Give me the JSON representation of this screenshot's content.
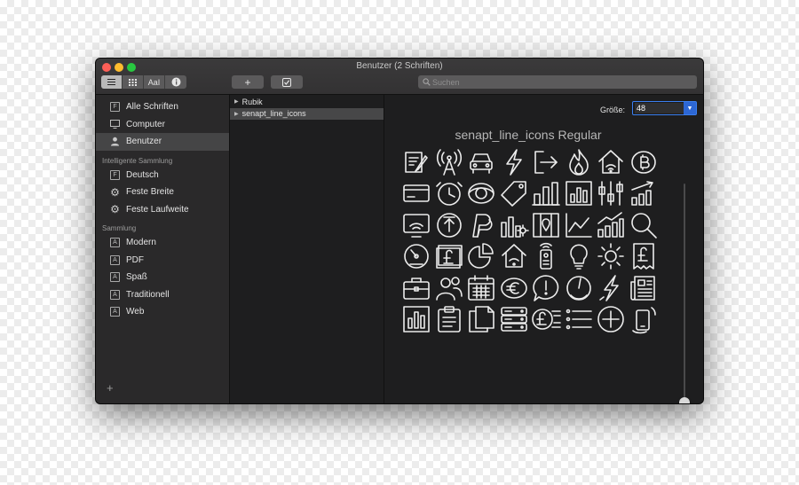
{
  "window": {
    "title": "Benutzer (2 Schriften)"
  },
  "toolbar": {
    "view_buttons": [
      "≡",
      "⋮⋮",
      "AaI",
      "i"
    ],
    "add_label": "+",
    "validate_label": "☑",
    "search_placeholder": "Suchen"
  },
  "sidebar": {
    "library": [
      {
        "label": "Alle Schriften",
        "icon": "font-book-icon"
      },
      {
        "label": "Computer",
        "icon": "monitor-icon"
      },
      {
        "label": "Benutzer",
        "icon": "user-icon",
        "selected": true
      }
    ],
    "smart_header": "Intelligente Sammlung",
    "smart": [
      {
        "label": "Deutsch",
        "icon": "font-book-icon"
      },
      {
        "label": "Feste Breite",
        "icon": "gear-icon"
      },
      {
        "label": "Feste Laufweite",
        "icon": "gear-icon"
      }
    ],
    "collection_header": "Sammlung",
    "collections": [
      {
        "label": "Modern",
        "icon": "font-a-icon"
      },
      {
        "label": "PDF",
        "icon": "font-a-icon"
      },
      {
        "label": "Spaß",
        "icon": "font-a-icon"
      },
      {
        "label": "Traditionell",
        "icon": "font-a-icon"
      },
      {
        "label": "Web",
        "icon": "font-a-icon"
      }
    ],
    "add_label": "+"
  },
  "font_list": [
    {
      "label": "Rubik",
      "selected": false
    },
    {
      "label": "senapt_line_icons",
      "selected": true
    }
  ],
  "preview": {
    "size_label": "Größe:",
    "size_value": "48",
    "font_title": "senapt_line_icons Regular",
    "size_slider_fraction": 0.17,
    "glyph_icons": [
      "note-edit-icon",
      "broadcast-tower-icon",
      "car-front-icon",
      "lightning-bolt-icon",
      "exit-arrow-icon",
      "flame-icon",
      "smart-home-icon",
      "bitcoin-coin-icon",
      "credit-card-icon",
      "clock-icon",
      "eye-target-icon",
      "price-tag-icon",
      "bar-chart-icon",
      "bar-chart-box-icon",
      "slider-controls-icon",
      "growth-bars-arrow-icon",
      "wifi-monitor-icon",
      "upload-circle-icon",
      "paypal-icon",
      "bars-gear-icon",
      "map-pin-book-icon",
      "line-chart-icon",
      "growth-bars-icon",
      "search-magnifier-icon",
      "speedometer-icon",
      "pound-card-icon",
      "pie-chart-icon",
      "home-wifi-icon",
      "remote-control-icon",
      "light-bulb-icon",
      "sun-icon",
      "pound-receipt-icon",
      "briefcase-icon",
      "team-users-icon",
      "calendar-icon",
      "euro-coin-icon",
      "alert-chat-icon",
      "gauge-icon",
      "lightning-icon",
      "newspaper-icon",
      "bar-chart-simple-icon",
      "clipboard-icon",
      "document-copy-icon",
      "server-stack-icon",
      "pound-coin-list-icon",
      "list-menu-icon",
      "plus-circle-icon",
      "mobile-signal-icon"
    ]
  },
  "colors": {
    "window_bg": "#1e1e1f",
    "sidebar_bg": "#2a292a",
    "selection": "#454546",
    "accent": "#2f6fdf"
  }
}
